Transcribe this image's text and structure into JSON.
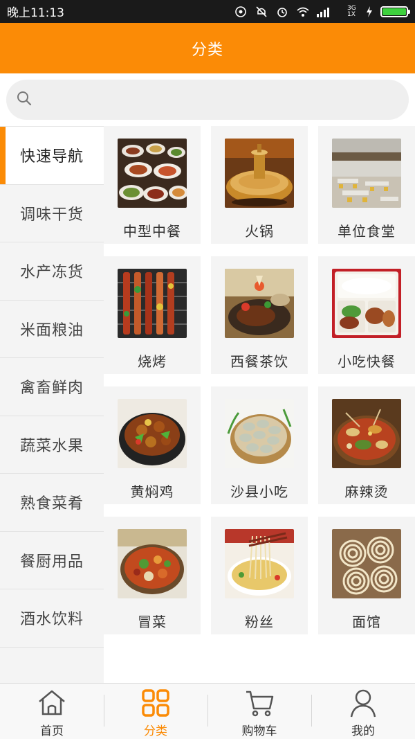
{
  "status_bar": {
    "time": "晚上11:13",
    "network_label": "3G 1X"
  },
  "header": {
    "title": "分类"
  },
  "search": {
    "placeholder": ""
  },
  "sidebar": {
    "items": [
      {
        "label": "快速导航",
        "active": true
      },
      {
        "label": "调味干货",
        "active": false
      },
      {
        "label": "水产冻货",
        "active": false
      },
      {
        "label": "米面粮油",
        "active": false
      },
      {
        "label": "禽畜鲜肉",
        "active": false
      },
      {
        "label": "蔬菜水果",
        "active": false
      },
      {
        "label": "熟食菜肴",
        "active": false
      },
      {
        "label": "餐厨用品",
        "active": false
      },
      {
        "label": "酒水饮料",
        "active": false
      }
    ]
  },
  "grid": {
    "items": [
      {
        "label": "中型中餐",
        "icon": "chinese-food-photo"
      },
      {
        "label": "火锅",
        "icon": "hotpot-photo"
      },
      {
        "label": "单位食堂",
        "icon": "canteen-photo"
      },
      {
        "label": "烧烤",
        "icon": "barbecue-photo"
      },
      {
        "label": "西餐茶饮",
        "icon": "western-food-photo"
      },
      {
        "label": "小吃快餐",
        "icon": "fast-food-photo"
      },
      {
        "label": "黄焖鸡",
        "icon": "braised-chicken-photo"
      },
      {
        "label": "沙县小吃",
        "icon": "dumplings-photo"
      },
      {
        "label": "麻辣烫",
        "icon": "malatang-photo"
      },
      {
        "label": "冒菜",
        "icon": "maocai-photo"
      },
      {
        "label": "粉丝",
        "icon": "noodles-photo"
      },
      {
        "label": "面馆",
        "icon": "noodle-shop-photo"
      }
    ]
  },
  "bottom_nav": {
    "items": [
      {
        "label": "首页",
        "icon": "home-icon",
        "active": false
      },
      {
        "label": "分类",
        "icon": "category-icon",
        "active": true
      },
      {
        "label": "购物车",
        "icon": "cart-icon",
        "active": false
      },
      {
        "label": "我的",
        "icon": "profile-icon",
        "active": false
      }
    ]
  },
  "colors": {
    "accent": "#fb8b06",
    "status_bar_bg": "#1a1a1a",
    "sidebar_bg": "#f4f4f4",
    "battery": "#3ed13e"
  }
}
